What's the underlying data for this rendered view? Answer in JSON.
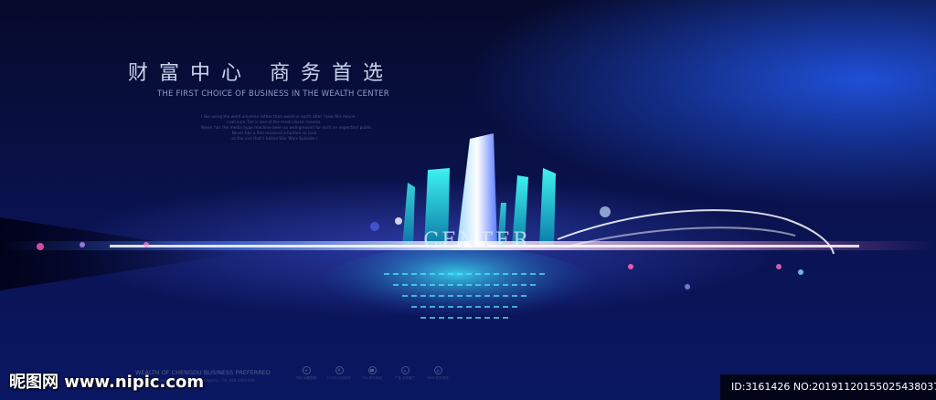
{
  "poster": {
    "headline": "财富中心 商务首选",
    "subheadline": "THE FIRST CHOICE OF BUSINESS IN THE WEALTH CENTER",
    "body_lines": [
      "I like using the word universe rather than world or earth after I saw this movie.",
      "I am sure Tim is one of the most classic movies.",
      "Never has the media hype machine been so well-greased for such an expectant public.",
      "Never has a film received a fanfare so loud",
      "as the one that's hailed Star Wars Episode I"
    ],
    "center_word": "CENTER",
    "tagline": "WEALTH OF CHENGDU    BUSINESS PREFERRED",
    "tagline_small": "Nemo enim ipsam voluptatem quia voluptas  ·  Tel: 028-XXXXXXX",
    "icons": [
      {
        "name": "location-icon",
        "label": "TBD 地图查看"
      },
      {
        "name": "price-icon",
        "label": "LOGO 公司名称"
      },
      {
        "name": "phone-icon",
        "label": "TEL 联系电话"
      },
      {
        "name": "home-icon",
        "label": "广告 合作推广"
      },
      {
        "name": "web-icon",
        "label": "WEB 官方网站"
      }
    ]
  },
  "watermark": {
    "site": "昵图网 www.nipic.com",
    "id_text": "ID:3161426 NO:20191120155025438037"
  },
  "colors": {
    "background_top": "#060a2b",
    "background_bottom": "#0a1762",
    "accent_blue": "#1f4fd6",
    "tower_cyan": "#1fd0cf",
    "glow_pink": "#ff6ec7"
  }
}
